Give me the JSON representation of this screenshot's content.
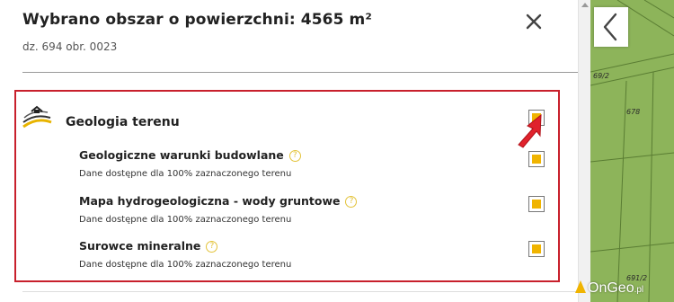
{
  "header": {
    "title": "Wybrano obszar o powierzchni: 4565 m²",
    "subtitle": "dz. 694 obr. 0023"
  },
  "section": {
    "title": "Geologia terenu",
    "items": [
      {
        "title": "Geologiczne warunki budowlane",
        "desc": "Dane dostępne dla 100% zaznaczonego terenu"
      },
      {
        "title": "Mapa hydrogeologiczna - wody gruntowe",
        "desc": "Dane dostępne dla 100% zaznaczonego terenu"
      },
      {
        "title": "Surowce mineralne",
        "desc": "Dane dostępne dla 100% zaznaczonego terenu"
      }
    ]
  },
  "help_glyph": "?",
  "map": {
    "labels": [
      "69/2",
      "678",
      "691/2"
    ]
  },
  "watermark": {
    "text": "OnGeo",
    "suffix": ".pl"
  },
  "colors": {
    "accent": "#f0b400",
    "highlight_border": "#c8202c",
    "map": "#8db45a"
  }
}
